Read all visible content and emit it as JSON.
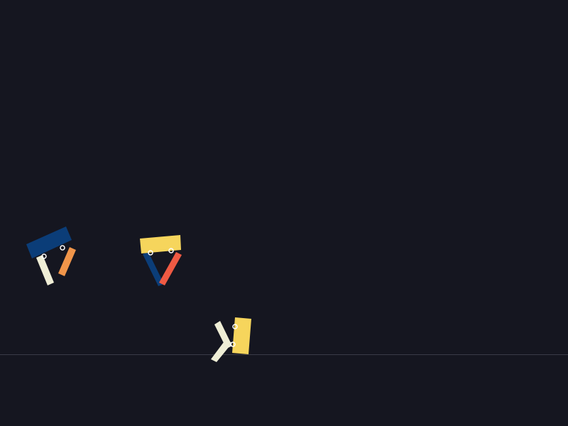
{
  "scene": {
    "background_color": "#151620",
    "ground_line_color": "#3a3b47"
  },
  "palette": {
    "blue": "#0b3d78",
    "yellow": "#f6d55c",
    "cream": "#efeed6",
    "orange": "#f0954a",
    "red": "#ef5a43",
    "joint_stroke": "#ffffff"
  },
  "creatures": [
    {
      "id": "creature-1",
      "body_color": "blue",
      "leg_colors": [
        "cream",
        "orange"
      ]
    },
    {
      "id": "creature-2",
      "body_color": "yellow",
      "leg_colors": [
        "blue",
        "red"
      ]
    },
    {
      "id": "creature-3",
      "body_color": "yellow",
      "leg_colors": [
        "cream",
        "cream"
      ]
    }
  ]
}
